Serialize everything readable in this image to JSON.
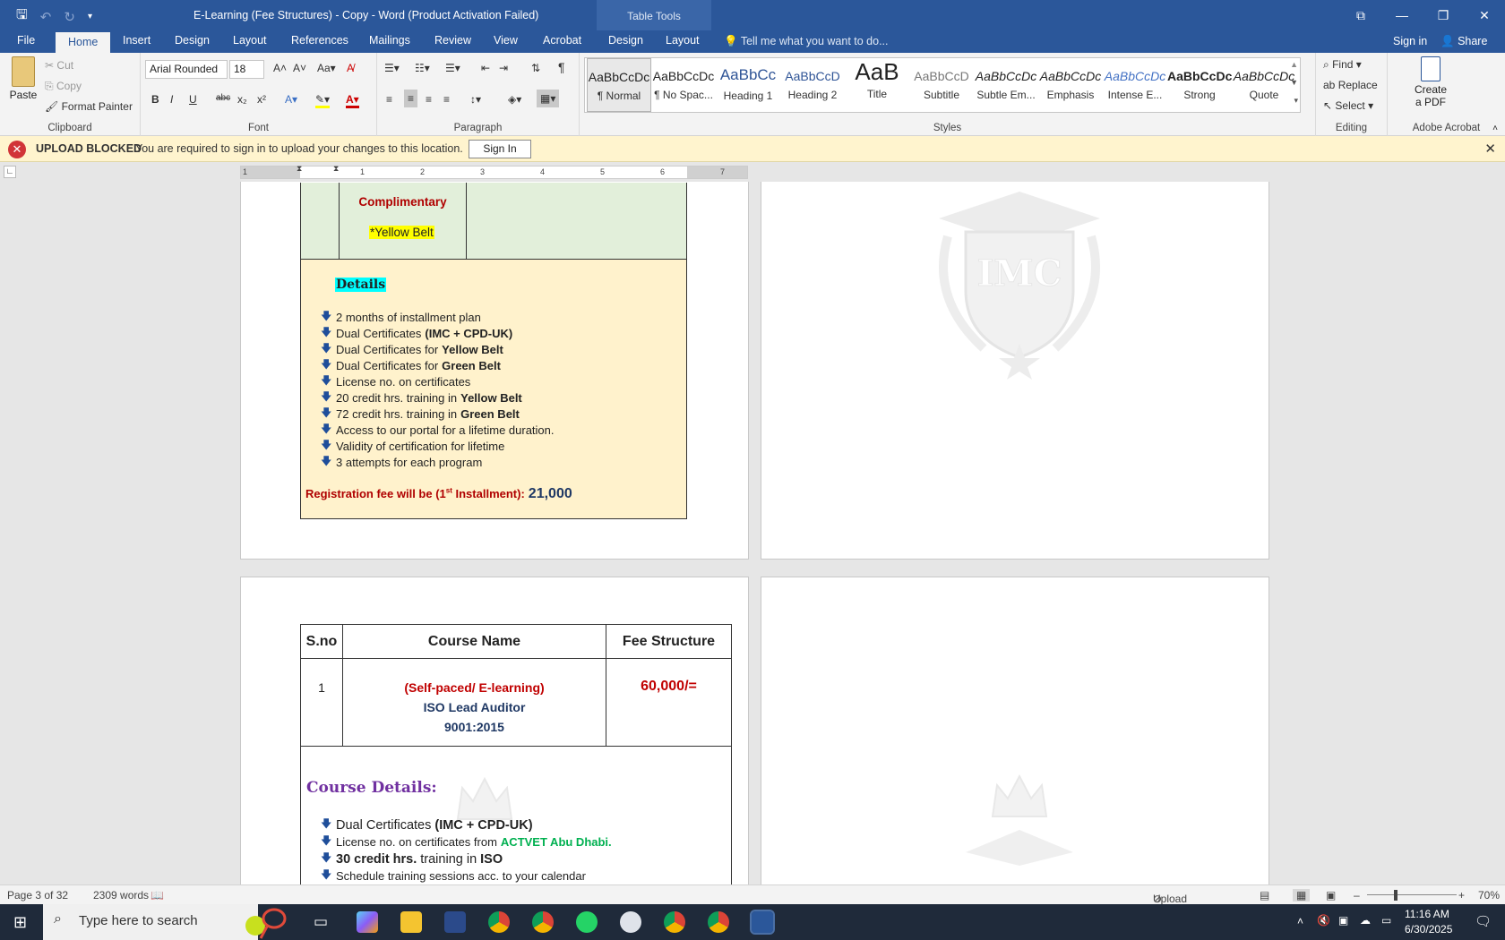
{
  "window": {
    "title": "E-Learning (Fee Structures) - Copy - Word (Product Activation Failed)",
    "context_tab": "Table Tools",
    "controls": [
      "⧉",
      "—",
      "❐",
      "✕"
    ]
  },
  "tabs": [
    "File",
    "Home",
    "Insert",
    "Design",
    "Layout",
    "References",
    "Mailings",
    "Review",
    "View",
    "Acrobat",
    "Design",
    "Layout"
  ],
  "tell_me": "Tell me what you want to do...",
  "sign_in": "Sign in",
  "share": "Share",
  "clipboard": {
    "paste": "Paste",
    "cut": "Cut",
    "copy": "Copy",
    "format_painter": "Format Painter",
    "label": "Clipboard"
  },
  "font": {
    "name": "Arial Rounded",
    "size": "18",
    "label": "Font",
    "buttons": [
      "B",
      "I",
      "U",
      "abc",
      "x₂",
      "x²"
    ]
  },
  "paragraph": {
    "label": "Paragraph"
  },
  "styles": {
    "label": "Styles",
    "items": [
      {
        "preview": "AaBbCcDc",
        "name": "¶ Normal"
      },
      {
        "preview": "AaBbCcDc",
        "name": "¶ No Spac..."
      },
      {
        "preview": "AaBbCc",
        "name": "Heading 1"
      },
      {
        "preview": "AaBbCcD",
        "name": "Heading 2"
      },
      {
        "preview": "AaB",
        "name": "Title"
      },
      {
        "preview": "AaBbCcD",
        "name": "Subtitle"
      },
      {
        "preview": "AaBbCcDc",
        "name": "Subtle Em..."
      },
      {
        "preview": "AaBbCcDc",
        "name": "Emphasis"
      },
      {
        "preview": "AaBbCcDc",
        "name": "Intense E..."
      },
      {
        "preview": "AaBbCcDc",
        "name": "Strong"
      },
      {
        "preview": "AaBbCcDc",
        "name": "Quote"
      }
    ]
  },
  "editing": {
    "find": "Find",
    "replace": "Replace",
    "select": "Select",
    "label": "Editing"
  },
  "acrobat": {
    "create_pdf_1": "Create",
    "create_pdf_2": "a PDF",
    "label": "Adobe Acrobat"
  },
  "message_bar": {
    "title": "UPLOAD BLOCKED",
    "text": "You are required to sign in to upload your changes to this location.",
    "button": "Sign In"
  },
  "ruler_marks": [
    "1",
    "1",
    "2",
    "3",
    "4",
    "5",
    "6",
    "7"
  ],
  "page1": {
    "complimentary": "Complimentary",
    "yellow_belt": "*Yellow Belt",
    "details_heading": "Details",
    "bullets": [
      {
        "text": "2 months of installment plan",
        "bold": ""
      },
      {
        "text": "Dual Certificates",
        "bold": "(IMC + CPD-UK)"
      },
      {
        "text": "Dual Certificates for",
        "bold": "Yellow Belt"
      },
      {
        "text": "Dual Certificates for",
        "bold": "Green Belt"
      },
      {
        "text": "License no. on certificates",
        "bold": ""
      },
      {
        "text": "20 credit hrs. training in",
        "bold": "Yellow Belt"
      },
      {
        "text": "72 credit hrs. training in",
        "bold": "Green Belt"
      },
      {
        "text": "Access to our portal for a lifetime duration.",
        "bold": ""
      },
      {
        "text": "Validity of certification for lifetime",
        "bold": ""
      },
      {
        "text": "3 attempts for each program",
        "bold": ""
      }
    ],
    "reg_fee_prefix": "Registration fee will be (1",
    "reg_fee_sup": "st",
    "reg_fee_suffix": " Installment):",
    "reg_fee_amount": "21,000"
  },
  "page2": {
    "headers": [
      "S.no",
      "Course Name",
      "Fee Structure"
    ],
    "row": {
      "sno": "1",
      "mode": "(Self-paced/ E-learning)",
      "course_1": "ISO Lead Auditor",
      "course_2": "9001:2015",
      "fee": "60,000/="
    },
    "course_details_heading": "Course Details:",
    "items": [
      {
        "text": "Dual Certificates",
        "bold": "(IMC + CPD-UK)"
      },
      {
        "text": "License no. on certificates from",
        "green": "ACTVET Abu Dhabi."
      },
      {
        "bold_first": "30 credit hrs.",
        "text": "training in",
        "bold": "ISO"
      },
      {
        "text": "Schedule training sessions acc. to your calendar"
      }
    ]
  },
  "watermark_text": "IMC",
  "status": {
    "page": "Page 3 of 32",
    "words": "2309 words",
    "upload": "Upload Failed",
    "zoom": "70%"
  },
  "taskbar": {
    "search_placeholder": "Type here to search",
    "time": "11:16 AM",
    "date": "6/30/2025"
  },
  "colors": {
    "word_blue": "#2b579a",
    "message_bar": "#fff4ce",
    "green_cell": "#e2efda",
    "details_bg": "#fff2cc",
    "dark_red": "#c00000",
    "navy": "#1f3864",
    "purple": "#7030a0"
  }
}
